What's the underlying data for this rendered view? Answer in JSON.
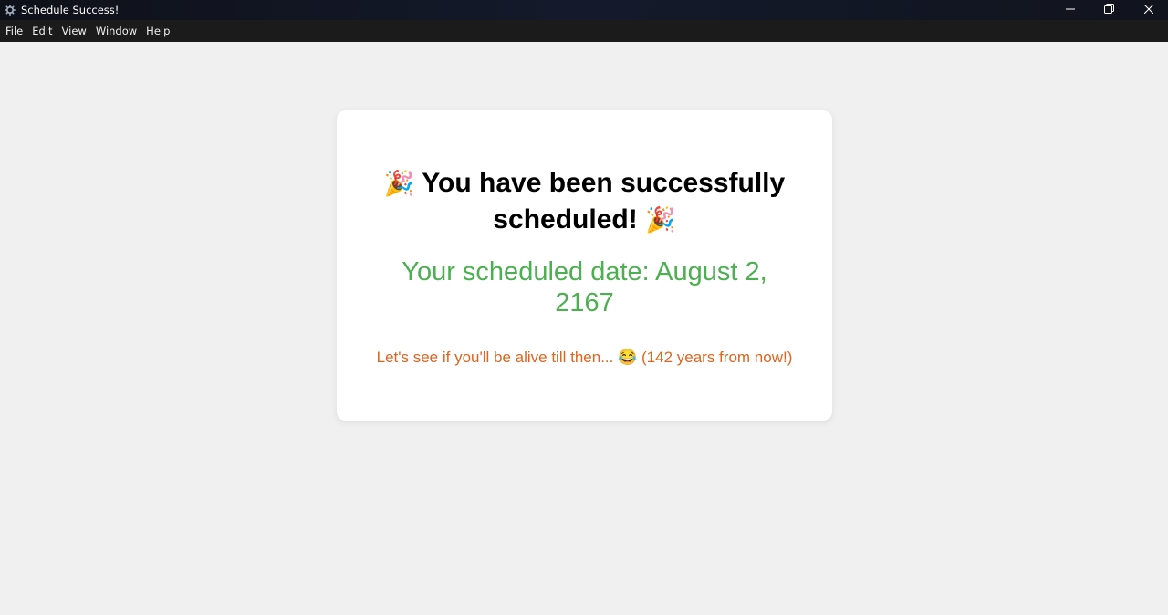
{
  "window": {
    "title": "Schedule Success!",
    "icons": {
      "app": "app-gear-icon",
      "minimize": "minimize-icon",
      "maximize": "maximize-icon",
      "close": "close-icon"
    }
  },
  "menu": {
    "items": [
      "File",
      "Edit",
      "View",
      "Window",
      "Help"
    ]
  },
  "card": {
    "headline_prefix_emoji": "🎉",
    "headline_text": "You have been successfully scheduled!",
    "headline_suffix_emoji": "🎉",
    "scheduled_label": "Your scheduled date: August 2, 2167",
    "note_prefix": "Let's see if you'll be alive till then...",
    "note_emoji": "😂",
    "note_suffix": "(142 years from now!)"
  },
  "colors": {
    "titlebar": "#141a2c",
    "menubar": "#1b1b1b",
    "background": "#f0f0f0",
    "card": "#ffffff",
    "headline": "#000000",
    "scheduled": "#4caf50",
    "note": "#e0641f"
  }
}
